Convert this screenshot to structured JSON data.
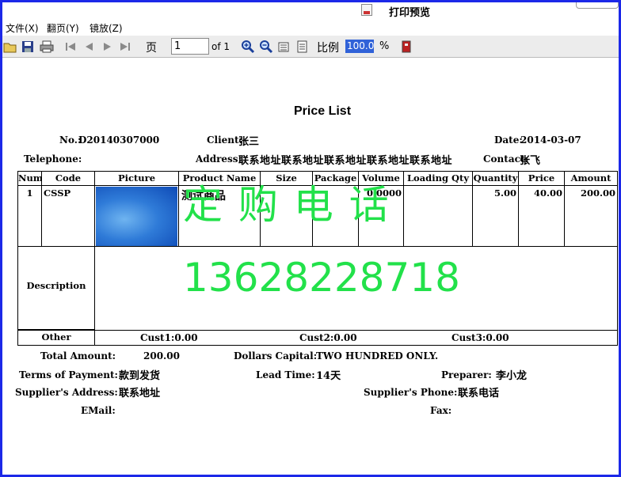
{
  "window": {
    "title": "打印预览"
  },
  "menu": {
    "file": "文件(X)",
    "page": "翻页(Y)",
    "zoom": "镜放(Z)"
  },
  "toolbar": {
    "page_label": "页",
    "page_value": "1",
    "page_total": "of 1",
    "ratio_label": "比例",
    "zoom_value": "100.0",
    "zoom_unit": "%"
  },
  "doc": {
    "title": "Price List",
    "no_label": "No.:",
    "no_value": "D20140307000",
    "client_label": "Client:",
    "client_value": "张三",
    "date_label": "Date:",
    "date_value": "2014-03-07",
    "telephone_label": "Telephone:",
    "telephone_value": "",
    "address_label": "Address:",
    "address_value": "联系地址联系地址联系地址联系地址联系地址",
    "contact_label": "Contact:",
    "contact_value": "张飞"
  },
  "table": {
    "headers": [
      "Num",
      "Code",
      "Picture",
      "Product Name",
      "Size",
      "Package",
      "Volume",
      "Loading Qty",
      "Quantity",
      "Price",
      "Amount"
    ],
    "rows": [
      {
        "num": "1",
        "code": "CSSP",
        "product_name": "测试商品",
        "size": "",
        "package": "",
        "volume": "0.0000",
        "loading_qty": "",
        "quantity": "5.00",
        "price": "40.00",
        "amount": "200.00"
      }
    ],
    "description_label": "Description",
    "other_label": "Other",
    "cust1": "Cust1:0.00",
    "cust2": "Cust2:0.00",
    "cust3": "Cust3:0.00"
  },
  "footer": {
    "total_amount_label": "Total  Amount:",
    "total_amount_value": "200.00",
    "dollars_capital_label": "Dollars  Capital:",
    "dollars_capital_value": "TWO  HUNDRED  ONLY.",
    "terms_label": "Terms of Payment:",
    "terms_value": "款到发货",
    "lead_time_label": "Lead Time:",
    "lead_time_value": "14天",
    "preparer_label": "Preparer:",
    "preparer_value": "李小龙",
    "supplier_address_label": "Supplier's  Address:",
    "supplier_address_value": "联系地址",
    "supplier_phone_label": "Supplier's  Phone:",
    "supplier_phone_value": "联系电话",
    "email_label": "EMail:",
    "email_value": "",
    "fax_label": "Fax:",
    "fax_value": ""
  },
  "watermark": {
    "line1": "定  购  电  话",
    "line2": "13628228718",
    "color": "#22e14a"
  },
  "colors": {
    "frame": "#1c28e8",
    "zoom_highlight": "#3062d8"
  }
}
